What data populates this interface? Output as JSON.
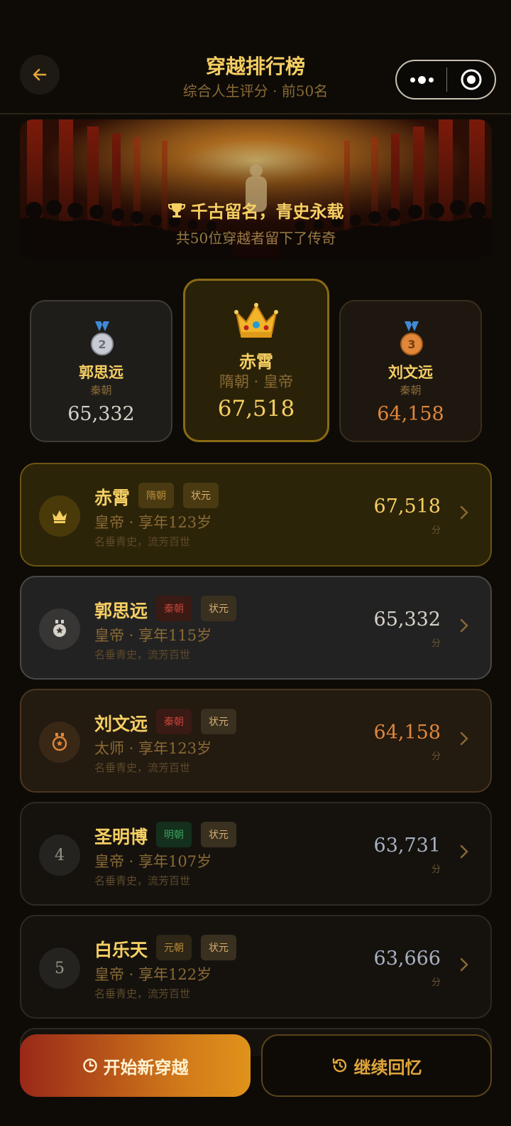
{
  "header": {
    "title": "穿越排行榜",
    "subtitle": "综合人生评分 · 前50名"
  },
  "banner": {
    "title": "千古留名，青史永载",
    "subtitle": "共50位穿越者留下了传奇"
  },
  "podium": {
    "second": {
      "name": "郭思远",
      "dynasty": "秦朝",
      "score": "65,332"
    },
    "first": {
      "name": "赤霄",
      "dynasty": "隋朝 · 皇帝",
      "score": "67,518"
    },
    "third": {
      "name": "刘文远",
      "dynasty": "秦朝",
      "score": "64,158"
    }
  },
  "list": [
    {
      "name": "赤霄",
      "dynasty": "隋朝",
      "title_tag": "状元",
      "role": "皇帝 · 享年123岁",
      "motto": "名垂青史，流芳百世",
      "score": "67,518",
      "unit": "分"
    },
    {
      "name": "郭思远",
      "dynasty": "秦朝",
      "title_tag": "状元",
      "role": "皇帝 · 享年115岁",
      "motto": "名垂青史，流芳百世",
      "score": "65,332",
      "unit": "分"
    },
    {
      "name": "刘文远",
      "dynasty": "秦朝",
      "title_tag": "状元",
      "role": "太师 · 享年123岁",
      "motto": "名垂青史，流芳百世",
      "score": "64,158",
      "unit": "分"
    },
    {
      "rank": "4",
      "name": "圣明博",
      "dynasty": "明朝",
      "title_tag": "状元",
      "role": "皇帝 · 享年107岁",
      "motto": "名垂青史，流芳百世",
      "score": "63,731",
      "unit": "分"
    },
    {
      "rank": "5",
      "name": "白乐天",
      "dynasty": "元朝",
      "title_tag": "状元",
      "role": "皇帝 · 享年122岁",
      "motto": "名垂青史，流芳百世",
      "score": "63,666",
      "unit": "分"
    }
  ],
  "buttons": {
    "start": "开始新穿越",
    "continue": "继续回忆"
  },
  "colors": {
    "gold": "#f6cf63",
    "bronze": "#e0873a",
    "silver": "#d7d2c8"
  }
}
